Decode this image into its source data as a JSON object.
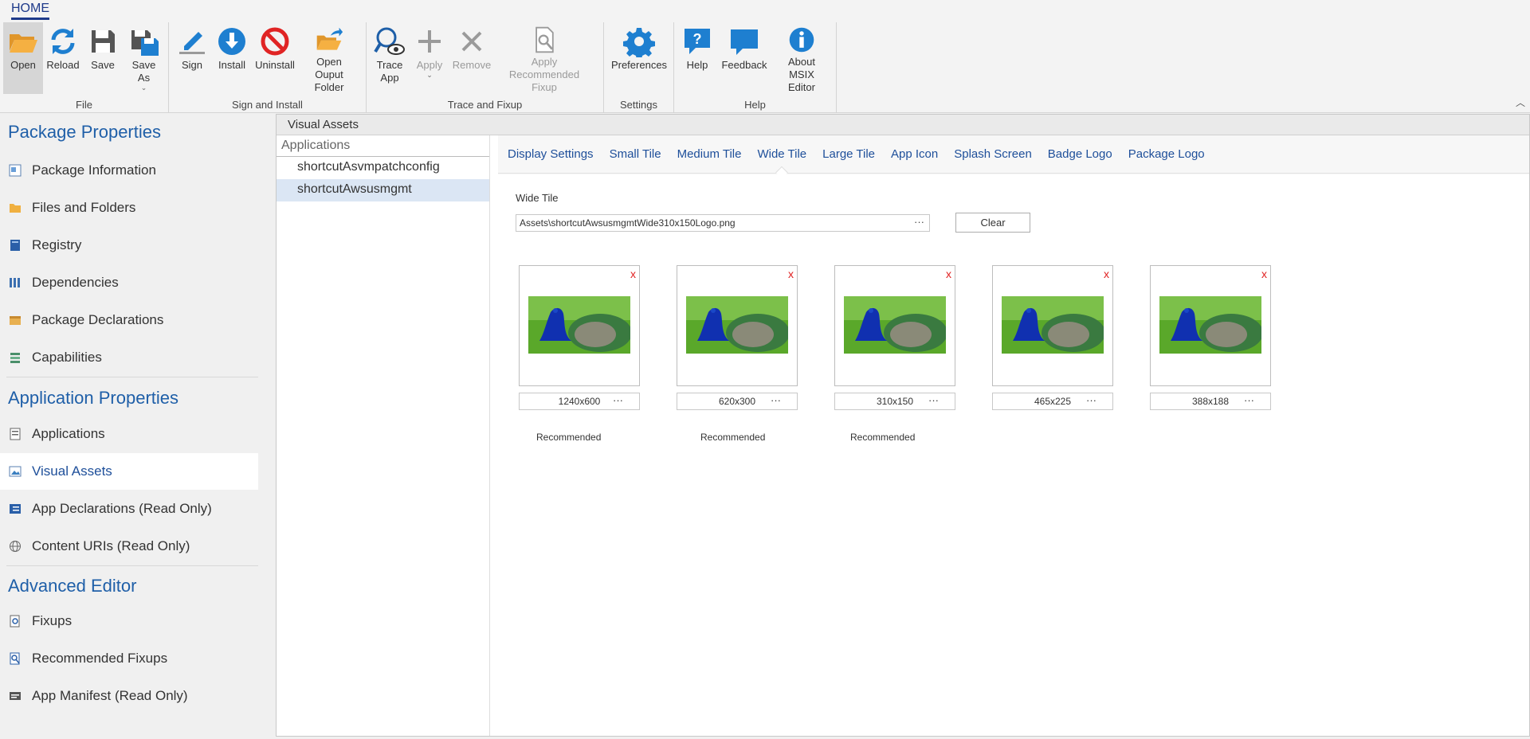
{
  "ribbon": {
    "tab": "HOME",
    "groups": [
      {
        "label": "File",
        "buttons": [
          {
            "label": "Open",
            "icon": "folder-open-icon"
          },
          {
            "label": "Reload",
            "icon": "reload-icon"
          },
          {
            "label": "Save",
            "icon": "save-icon"
          },
          {
            "label": "Save As",
            "icon": "save-as-icon"
          }
        ]
      },
      {
        "label": "Sign and Install",
        "buttons": [
          {
            "label": "Sign",
            "icon": "sign-pen-icon"
          },
          {
            "label": "Install",
            "icon": "install-download-icon"
          },
          {
            "label": "Uninstall",
            "icon": "uninstall-block-icon"
          },
          {
            "label": "Open Ouput\nFolder",
            "icon": "open-output-folder-icon"
          }
        ]
      },
      {
        "label": "Trace and Fixup",
        "buttons": [
          {
            "label": "Trace\nApp",
            "icon": "trace-app-icon"
          },
          {
            "label": "Apply",
            "icon": "apply-plus-icon"
          },
          {
            "label": "Remove",
            "icon": "remove-x-icon"
          },
          {
            "label": "Apply Recommended\nFixup",
            "icon": "apply-recommended-fixup-icon"
          }
        ]
      },
      {
        "label": "Settings",
        "buttons": [
          {
            "label": "Preferences",
            "icon": "gear-icon"
          }
        ]
      },
      {
        "label": "Help",
        "buttons": [
          {
            "label": "Help",
            "icon": "help-icon"
          },
          {
            "label": "Feedback",
            "icon": "feedback-icon"
          },
          {
            "label": "About MSIX\nEditor",
            "icon": "info-icon"
          }
        ]
      }
    ]
  },
  "nav": {
    "sections": [
      {
        "title": "Package Properties",
        "items": [
          {
            "label": "Package Information",
            "icon": "package-info-icon"
          },
          {
            "label": "Files and Folders",
            "icon": "folder-icon"
          },
          {
            "label": "Registry",
            "icon": "registry-icon"
          },
          {
            "label": "Dependencies",
            "icon": "dependencies-icon"
          },
          {
            "label": "Package Declarations",
            "icon": "package-declarations-icon"
          },
          {
            "label": "Capabilities",
            "icon": "capabilities-icon"
          }
        ]
      },
      {
        "title": "Application Properties",
        "items": [
          {
            "label": "Applications",
            "icon": "applications-icon"
          },
          {
            "label": "Visual Assets",
            "icon": "visual-assets-icon"
          },
          {
            "label": "App Declarations (Read Only)",
            "icon": "app-declarations-icon"
          },
          {
            "label": "Content URIs (Read Only)",
            "icon": "globe-icon"
          }
        ]
      },
      {
        "title": "Advanced Editor",
        "items": [
          {
            "label": "Fixups",
            "icon": "fixups-icon"
          },
          {
            "label": "Recommended Fixups",
            "icon": "recommended-fixups-icon"
          },
          {
            "label": "App Manifest (Read Only)",
            "icon": "app-manifest-icon"
          }
        ]
      }
    ]
  },
  "main": {
    "header": "Visual Assets",
    "apps_header": "Applications",
    "apps": [
      "shortcutAsvmpatchconfig",
      "shortcutAwsusmgmt"
    ],
    "tabs": [
      "Display Settings",
      "Small Tile",
      "Medium Tile",
      "Wide Tile",
      "Large Tile",
      "App Icon",
      "Splash Screen",
      "Badge Logo",
      "Package Logo"
    ],
    "pane_label": "Wide Tile",
    "path": "Assets\\shortcutAwsusmgmtWide310x150Logo.png",
    "path_dots": "···",
    "clear_label": "Clear",
    "thumb_close": "x",
    "thumb_dots": "···",
    "sizes": [
      "1240x600",
      "620x300",
      "310x150",
      "465x225",
      "388x188"
    ],
    "recommended": [
      "Recommended",
      "Recommended",
      "Recommended"
    ]
  },
  "colors": {
    "accent": "#1f5fa8",
    "ribbon_icon_blue": "#1e7fd0",
    "uninstall_red": "#e02424",
    "folder_orange": "#f0a030",
    "close_red": "#e02020"
  }
}
